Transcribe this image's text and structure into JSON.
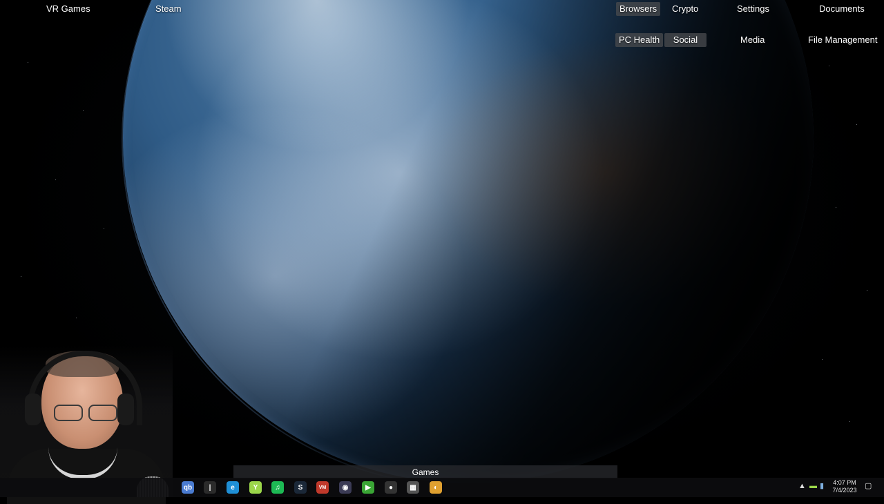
{
  "desktop": {
    "fences": [
      {
        "label": "VR Games"
      },
      {
        "label": "Steam"
      },
      {
        "label": "Browsers"
      },
      {
        "label": "Crypto"
      },
      {
        "label": "Settings"
      },
      {
        "label": "Documents"
      },
      {
        "label": "PC Health"
      },
      {
        "label": "Social"
      },
      {
        "label": "Media"
      },
      {
        "label": "File Management"
      },
      {
        "label": "Games"
      }
    ]
  },
  "taskbar": {
    "apps": [
      {
        "icon": "qbittorrent-icon",
        "text": "qb",
        "color": "#4a7bd0"
      },
      {
        "icon": "terminal-icon",
        "text": "|",
        "color": "#2b2b2b"
      },
      {
        "icon": "edge-browser-icon",
        "text": "e",
        "color": "#1f8fd6"
      },
      {
        "icon": "robinhood-icon",
        "text": "Y",
        "color": "#9bd64a"
      },
      {
        "icon": "spotify-icon",
        "text": "♫",
        "color": "#1db954"
      },
      {
        "icon": "steam-icon",
        "text": "S",
        "color": "#1b2838"
      },
      {
        "icon": "voicemeeter-icon",
        "text": "VM",
        "color": "#c0392b"
      },
      {
        "icon": "obs-icon",
        "text": "◉",
        "color": "#3b3b55"
      },
      {
        "icon": "nvidia-icon",
        "text": "▶",
        "color": "#3aa535"
      },
      {
        "icon": "recorder-icon",
        "text": "●",
        "color": "#333"
      },
      {
        "icon": "app-grid-icon",
        "text": "▦",
        "color": "#555"
      },
      {
        "icon": "chrome-canary-icon",
        "text": "◐",
        "color": "#e0a030"
      }
    ],
    "clock": {
      "time": "4:07 PM",
      "date": "7/4/2023"
    }
  }
}
